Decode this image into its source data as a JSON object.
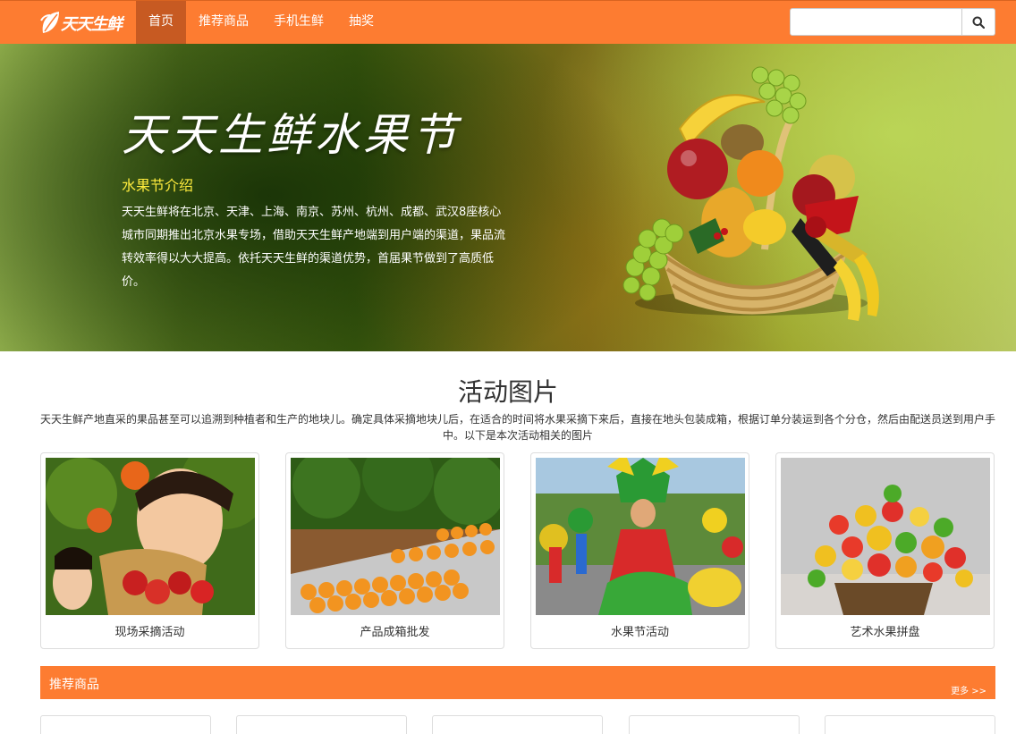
{
  "brand": {
    "name": "天天生鲜"
  },
  "nav": {
    "items": [
      {
        "label": "首页",
        "active": true
      },
      {
        "label": "推荐商品",
        "active": false
      },
      {
        "label": "手机生鲜",
        "active": false
      },
      {
        "label": "抽奖",
        "active": false
      }
    ]
  },
  "search": {
    "placeholder": "",
    "icon": "search-icon"
  },
  "hero": {
    "title": "天天生鲜水果节",
    "subtitle": "水果节介绍",
    "description": "天天生鲜将在北京、天津、上海、南京、苏州、杭州、成都、武汉8座核心城市同期推出北京水果专场，借助天天生鲜产地端到用户端的渠道，果品流转效率得以大大提高。依托天天生鲜的渠道优势，首届果节做到了高质低价。"
  },
  "activity": {
    "title": "活动图片",
    "description": "天天生鲜产地直采的果品甚至可以追溯到种植者和生产的地块儿。确定具体采摘地块儿后，在适合的时间将水果采摘下来后，直接在地头包装成箱，根据订单分装运到各个分仓，然后由配送员送到用户手中。以下是本次活动相关的图片",
    "cards": [
      {
        "caption": "现场采摘活动"
      },
      {
        "caption": "产品成箱批发"
      },
      {
        "caption": "水果节活动"
      },
      {
        "caption": "艺术水果拼盘"
      }
    ]
  },
  "recommend": {
    "title": "推荐商品",
    "more": "更多 >>"
  },
  "colors": {
    "accent": "#fd7c31",
    "accent_dark": "#c75a22",
    "highlight": "#ffec3d"
  }
}
